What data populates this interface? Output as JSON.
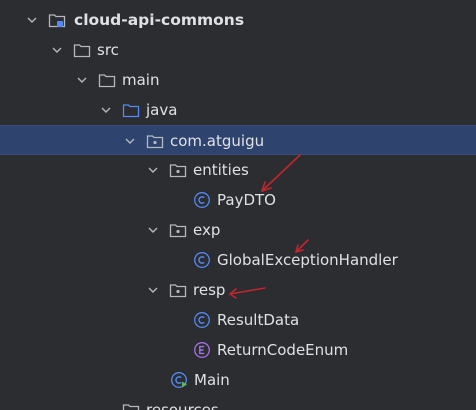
{
  "tree": {
    "items": [
      {
        "label": "cloud-api-commons",
        "icon": "module-folder-icon",
        "expanded": true
      },
      {
        "label": "src",
        "icon": "folder-icon",
        "expanded": true
      },
      {
        "label": "main",
        "icon": "folder-icon",
        "expanded": true
      },
      {
        "label": "java",
        "icon": "source-root-folder-icon",
        "expanded": true
      },
      {
        "label": "com.atguigu",
        "icon": "package-icon",
        "expanded": true,
        "selected": true
      },
      {
        "label": "entities",
        "icon": "package-icon",
        "expanded": true
      },
      {
        "label": "PayDTO",
        "icon": "class-icon"
      },
      {
        "label": "exp",
        "icon": "package-icon",
        "expanded": true
      },
      {
        "label": "GlobalExceptionHandler",
        "icon": "class-icon"
      },
      {
        "label": "resp",
        "icon": "package-icon",
        "expanded": true
      },
      {
        "label": "ResultData",
        "icon": "class-icon"
      },
      {
        "label": "ReturnCodeEnum",
        "icon": "enum-icon"
      },
      {
        "label": "Main",
        "icon": "runnable-class-icon"
      },
      {
        "label": "resources",
        "icon": "folder-icon"
      }
    ]
  },
  "colors": {
    "background": "#2b2d30",
    "selection": "#2e436e",
    "class_icon": "#548af7",
    "enum_icon": "#a571e6",
    "annotation_arrow": "#c0262f"
  }
}
